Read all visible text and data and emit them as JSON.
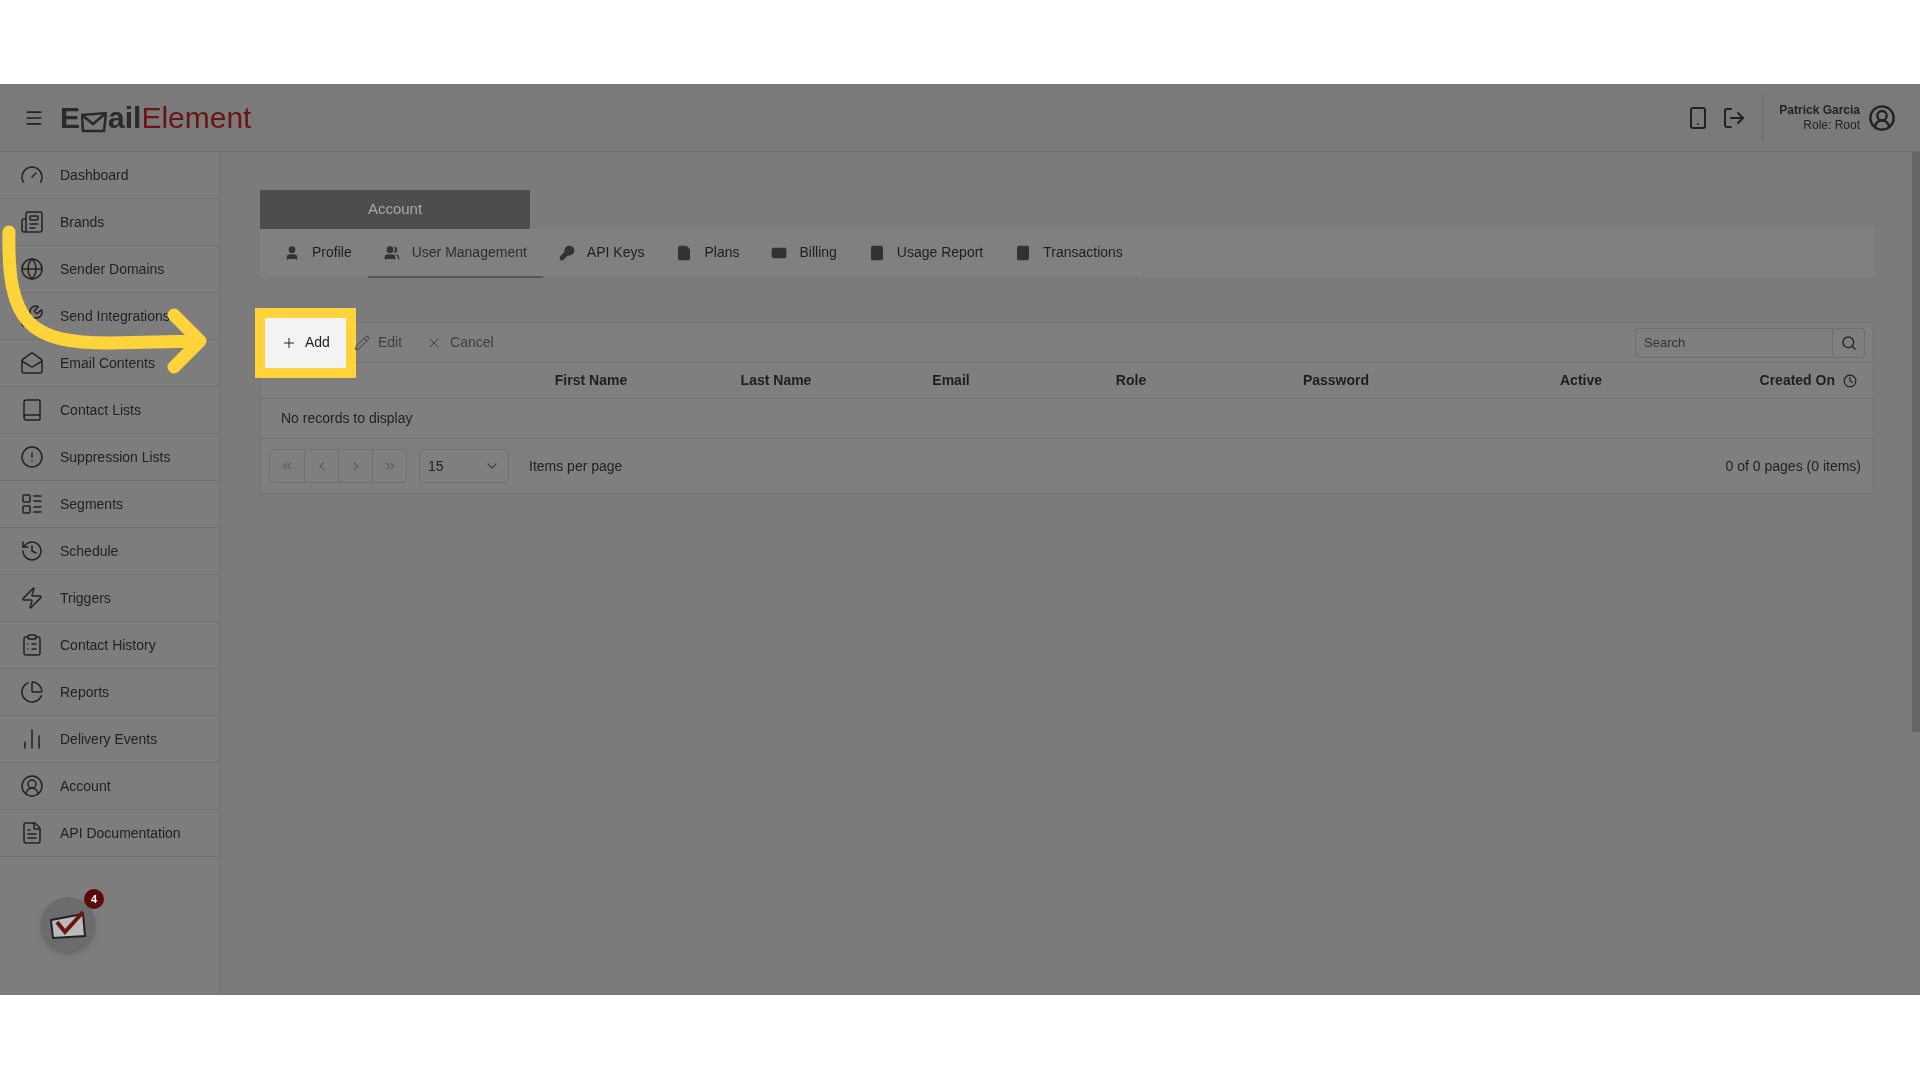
{
  "header": {
    "logo_dark": "E",
    "logo_mid": "ail",
    "logo_red": "Element",
    "user_name": "Patrick Garcia",
    "user_role": "Role: Root"
  },
  "sidebar": {
    "items": [
      {
        "label": "Dashboard"
      },
      {
        "label": "Brands"
      },
      {
        "label": "Sender Domains"
      },
      {
        "label": "Send Integrations"
      },
      {
        "label": "Email Contents"
      },
      {
        "label": "Contact Lists"
      },
      {
        "label": "Suppression Lists"
      },
      {
        "label": "Segments"
      },
      {
        "label": "Schedule"
      },
      {
        "label": "Triggers"
      },
      {
        "label": "Contact History"
      },
      {
        "label": "Reports"
      },
      {
        "label": "Delivery Events"
      },
      {
        "label": "Account"
      },
      {
        "label": "API Documentation"
      }
    ],
    "notification_count": "4"
  },
  "page_title": "Account",
  "tabs": [
    {
      "label": "Profile",
      "selected": false
    },
    {
      "label": "User Management",
      "selected": true
    },
    {
      "label": "API Keys",
      "selected": false
    },
    {
      "label": "Plans",
      "selected": false
    },
    {
      "label": "Billing",
      "selected": false
    },
    {
      "label": "Usage Report",
      "selected": false
    },
    {
      "label": "Transactions",
      "selected": false
    }
  ],
  "toolbar": {
    "buttons": [
      {
        "label": "Add",
        "disabled": false,
        "highlighted": true
      },
      {
        "label": "Edit",
        "disabled": true,
        "highlighted": false
      },
      {
        "label": "Cancel",
        "disabled": true,
        "highlighted": false
      }
    ],
    "search": {
      "placeholder": "Search"
    }
  },
  "table": {
    "columns": [
      "First Name",
      "Last Name",
      "Email",
      "Role",
      "Password",
      "Active",
      "Created On"
    ],
    "empty_message": "No records to display"
  },
  "pager": {
    "page_size": "15",
    "page_size_label": "Items per page",
    "summary": "0 of 0 pages (0 items)"
  }
}
